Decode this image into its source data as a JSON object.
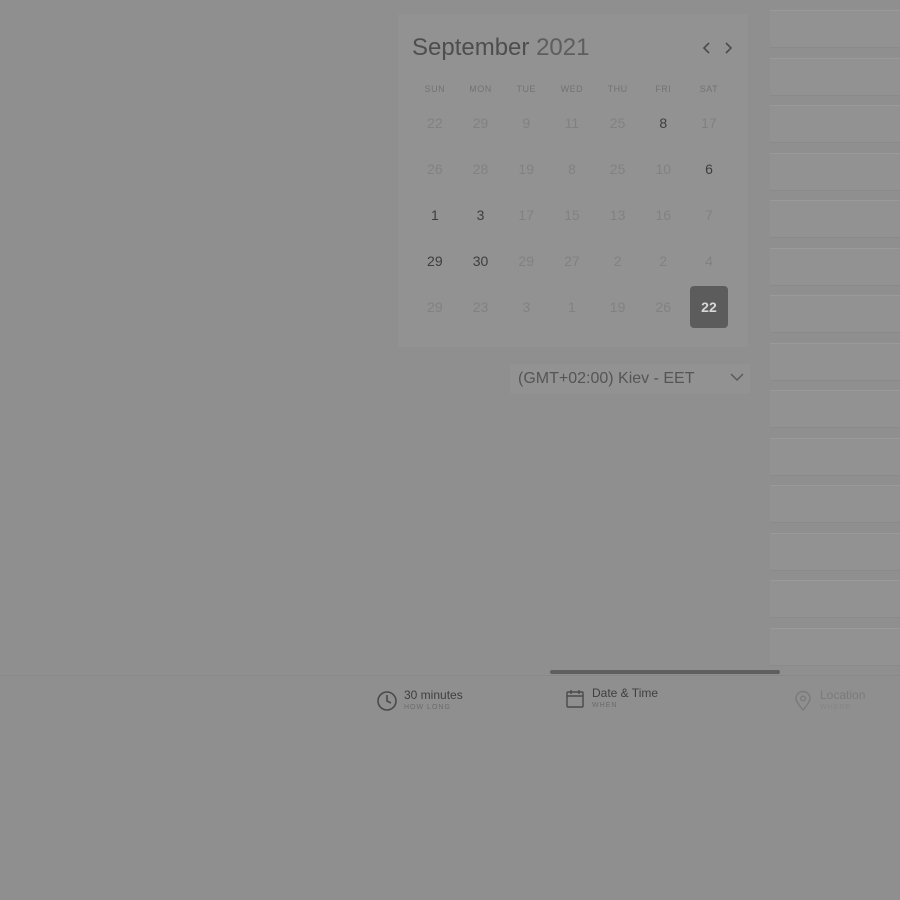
{
  "calendar": {
    "month": "September",
    "year": "2021",
    "weekdays": [
      "SUN",
      "MON",
      "TUE",
      "WED",
      "THU",
      "FRI",
      "SAT"
    ],
    "weeks": [
      [
        {
          "d": "22",
          "s": "dim"
        },
        {
          "d": "29",
          "s": "dim"
        },
        {
          "d": "9",
          "s": "dim"
        },
        {
          "d": "11",
          "s": "dim"
        },
        {
          "d": "25",
          "s": "dim"
        },
        {
          "d": "8",
          "s": "available"
        },
        {
          "d": "17",
          "s": "dim"
        }
      ],
      [
        {
          "d": "26",
          "s": "dim"
        },
        {
          "d": "28",
          "s": "dim"
        },
        {
          "d": "19",
          "s": "dim"
        },
        {
          "d": "8",
          "s": "dim"
        },
        {
          "d": "25",
          "s": "dim"
        },
        {
          "d": "10",
          "s": "dim"
        },
        {
          "d": "6",
          "s": "available"
        }
      ],
      [
        {
          "d": "1",
          "s": "available"
        },
        {
          "d": "3",
          "s": "available"
        },
        {
          "d": "17",
          "s": "dim"
        },
        {
          "d": "15",
          "s": "dim"
        },
        {
          "d": "13",
          "s": "dim"
        },
        {
          "d": "16",
          "s": "dim"
        },
        {
          "d": "7",
          "s": "dim"
        }
      ],
      [
        {
          "d": "29",
          "s": "available"
        },
        {
          "d": "30",
          "s": "available"
        },
        {
          "d": "29",
          "s": "dim"
        },
        {
          "d": "27",
          "s": "dim"
        },
        {
          "d": "2",
          "s": "dim"
        },
        {
          "d": "2",
          "s": "dim"
        },
        {
          "d": "4",
          "s": "dim"
        }
      ],
      [
        {
          "d": "29",
          "s": "dim"
        },
        {
          "d": "23",
          "s": "dim"
        },
        {
          "d": "3",
          "s": "dim"
        },
        {
          "d": "1",
          "s": "dim"
        },
        {
          "d": "19",
          "s": "dim"
        },
        {
          "d": "26",
          "s": "dim"
        },
        {
          "d": "22",
          "s": "selected"
        }
      ]
    ]
  },
  "timezone": {
    "label": "(GMT+02:00) Kiev - EET"
  },
  "slots": {
    "count_visible": 14
  },
  "steps": {
    "duration": {
      "title": "30 minutes",
      "sub": "HOW LONG",
      "icon": "clock-icon"
    },
    "datetime": {
      "title": "Date & Time",
      "sub": "WHEN",
      "icon": "calendar-icon"
    },
    "location": {
      "title": "Location",
      "sub": "WHERE",
      "icon": "location-pin-icon"
    }
  },
  "colors": {
    "overlay": "#8f8f8f",
    "selected": "#5c5c5c"
  }
}
